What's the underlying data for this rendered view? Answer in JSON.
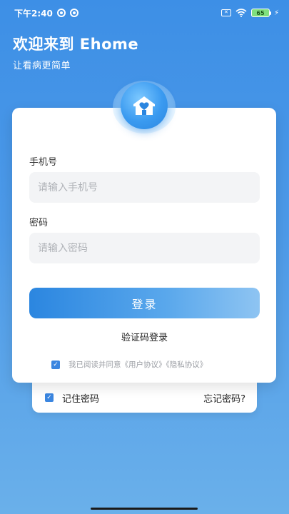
{
  "status_bar": {
    "time": "下午2:40",
    "battery": "65"
  },
  "header": {
    "title": "欢迎来到 Ehome",
    "subtitle": "让看病更简单"
  },
  "form": {
    "phone_label": "手机号",
    "phone_placeholder": "请输入手机号",
    "password_label": "密码",
    "password_placeholder": "请输入密码",
    "login_label": "登录",
    "sms_login_label": "验证码登录",
    "agreement_text": "我已阅读并同意《用户协议》《隐私协议》",
    "agreement_checked": true
  },
  "footer_card": {
    "remember_label": "记住密码",
    "remember_checked": true,
    "forgot_label": "忘记密码?"
  },
  "colors": {
    "accent": "#2b86e0",
    "background_top": "#3d8fe6",
    "background_bottom": "#6ab0ea"
  },
  "icons": [
    "house-heart-icon",
    "checkbox-icon",
    "wifi-icon",
    "battery-icon"
  ]
}
